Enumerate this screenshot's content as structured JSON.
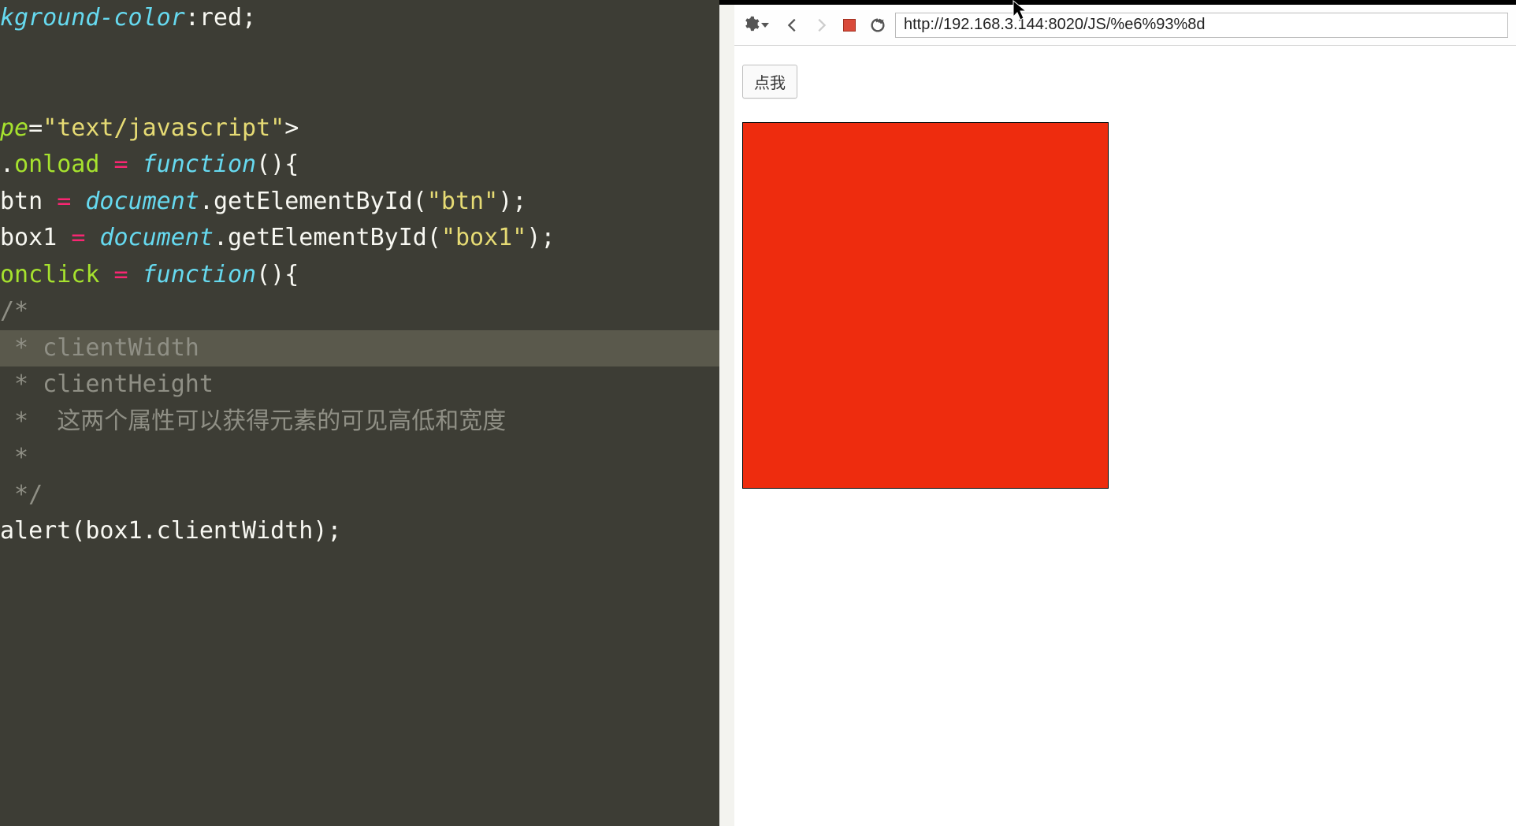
{
  "editor": {
    "lines": [
      {
        "hl": false,
        "tokens": [
          {
            "cls": "tok-prop",
            "t": "kground-color"
          },
          {
            "cls": "tok-punct",
            "t": ":"
          },
          {
            "cls": "tok-plain",
            "t": "red"
          },
          {
            "cls": "tok-punct",
            "t": ";"
          }
        ]
      },
      {
        "hl": false,
        "tokens": []
      },
      {
        "hl": false,
        "tokens": []
      },
      {
        "hl": false,
        "tokens": [
          {
            "cls": "tok-attr",
            "t": "pe"
          },
          {
            "cls": "tok-punct",
            "t": "="
          },
          {
            "cls": "tok-string",
            "t": "\"text/javascript\""
          },
          {
            "cls": "tok-punct",
            "t": ">"
          }
        ]
      },
      {
        "hl": false,
        "tokens": [
          {
            "cls": "tok-punct",
            "t": "."
          },
          {
            "cls": "tok-name",
            "t": "onload"
          },
          {
            "cls": "tok-plain",
            "t": " "
          },
          {
            "cls": "tok-operator",
            "t": "="
          },
          {
            "cls": "tok-plain",
            "t": " "
          },
          {
            "cls": "tok-func",
            "t": "function"
          },
          {
            "cls": "tok-punct",
            "t": "(){"
          }
        ]
      },
      {
        "hl": false,
        "tokens": [
          {
            "cls": "tok-plain",
            "t": "btn "
          },
          {
            "cls": "tok-operator",
            "t": "="
          },
          {
            "cls": "tok-plain",
            "t": " "
          },
          {
            "cls": "tok-obj",
            "t": "document"
          },
          {
            "cls": "tok-punct",
            "t": "."
          },
          {
            "cls": "tok-plain",
            "t": "getElementById("
          },
          {
            "cls": "tok-string2",
            "t": "\"btn\""
          },
          {
            "cls": "tok-plain",
            "t": ");"
          }
        ]
      },
      {
        "hl": false,
        "tokens": [
          {
            "cls": "tok-plain",
            "t": "box1 "
          },
          {
            "cls": "tok-operator",
            "t": "="
          },
          {
            "cls": "tok-plain",
            "t": " "
          },
          {
            "cls": "tok-obj",
            "t": "document"
          },
          {
            "cls": "tok-punct",
            "t": "."
          },
          {
            "cls": "tok-plain",
            "t": "getElementById("
          },
          {
            "cls": "tok-string2",
            "t": "\"box1\""
          },
          {
            "cls": "tok-plain",
            "t": ");"
          }
        ]
      },
      {
        "hl": false,
        "tokens": [
          {
            "cls": "tok-name",
            "t": "onclick"
          },
          {
            "cls": "tok-plain",
            "t": " "
          },
          {
            "cls": "tok-operator",
            "t": "="
          },
          {
            "cls": "tok-plain",
            "t": " "
          },
          {
            "cls": "tok-func",
            "t": "function"
          },
          {
            "cls": "tok-punct",
            "t": "(){"
          }
        ]
      },
      {
        "hl": false,
        "tokens": [
          {
            "cls": "tok-comment",
            "t": "/*"
          }
        ]
      },
      {
        "hl": true,
        "tokens": [
          {
            "cls": "tok-comment",
            "t": " * clientWidth"
          }
        ]
      },
      {
        "hl": false,
        "tokens": [
          {
            "cls": "tok-comment",
            "t": " * clientHeight"
          }
        ]
      },
      {
        "hl": false,
        "tokens": [
          {
            "cls": "tok-comment",
            "t": " *  这两个属性可以获得元素的可见高低和宽度"
          }
        ]
      },
      {
        "hl": false,
        "tokens": [
          {
            "cls": "tok-comment",
            "t": " * "
          }
        ]
      },
      {
        "hl": false,
        "tokens": [
          {
            "cls": "tok-comment",
            "t": " */"
          }
        ]
      },
      {
        "hl": false,
        "tokens": [
          {
            "cls": "tok-plain",
            "t": "alert(box1.clientWidth);"
          }
        ]
      }
    ]
  },
  "browser": {
    "url": "http://192.168.3.144:8020/JS/%e6%93%8d",
    "button_label": "点我"
  }
}
